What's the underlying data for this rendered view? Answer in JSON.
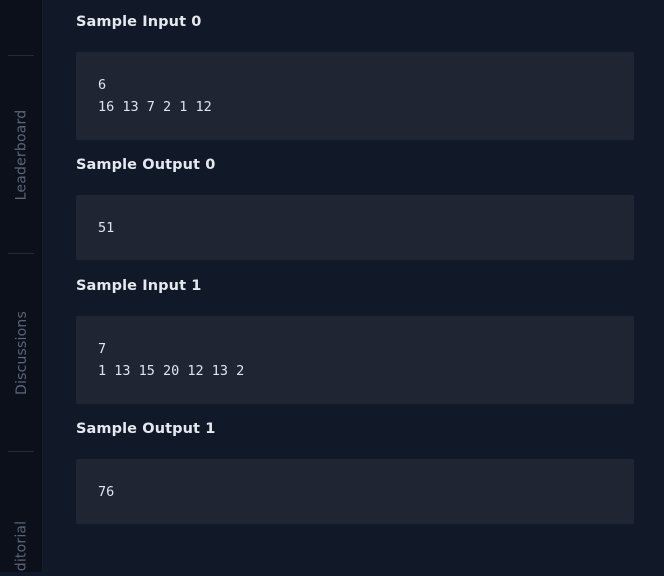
{
  "sidebar": {
    "tabs": [
      {
        "label": "Leaderboard"
      },
      {
        "label": "Discussions"
      },
      {
        "label": "ditorial"
      }
    ]
  },
  "samples": [
    {
      "title": "Sample Input 0",
      "lines": [
        "6",
        "16 13 7 2 1 12"
      ]
    },
    {
      "title": "Sample Output 0",
      "lines": [
        "51"
      ]
    },
    {
      "title": "Sample Input 1",
      "lines": [
        "7",
        "1 13 15 20 12 13 2"
      ]
    },
    {
      "title": "Sample Output 1",
      "lines": [
        "76"
      ]
    }
  ]
}
